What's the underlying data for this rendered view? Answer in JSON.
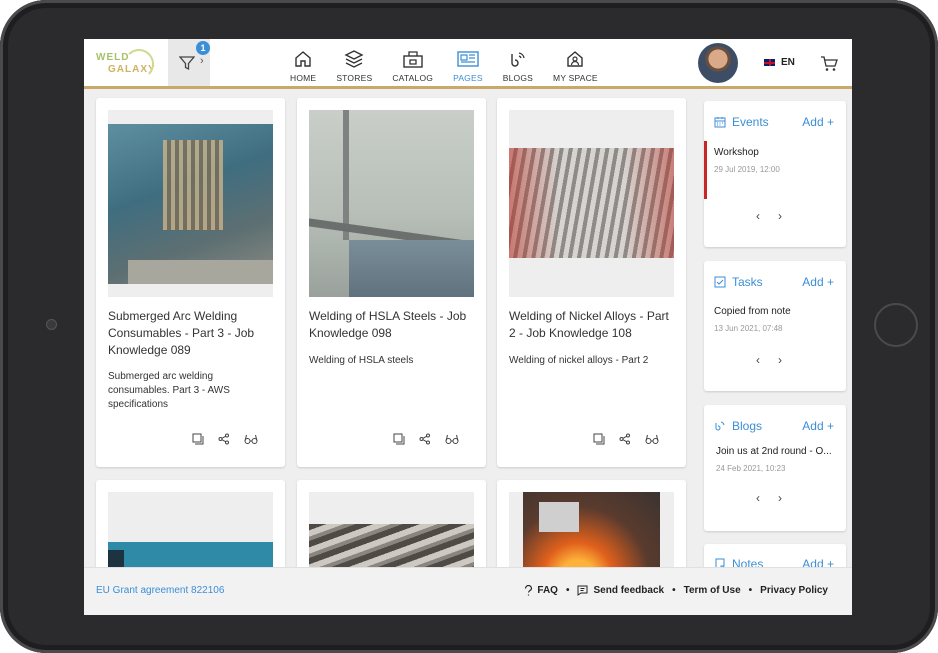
{
  "header": {
    "logo_line1": "WELD",
    "logo_line2": "GALAXY",
    "filter_badge": "1",
    "filter_chevron": "›",
    "nav": [
      {
        "label": "HOME",
        "icon": "home-icon"
      },
      {
        "label": "STORES",
        "icon": "layers-icon"
      },
      {
        "label": "CATALOG",
        "icon": "catalog-icon"
      },
      {
        "label": "PAGES",
        "icon": "pages-icon",
        "active": true
      },
      {
        "label": "BLOGS",
        "icon": "blogs-icon"
      },
      {
        "label": "MY SPACE",
        "icon": "myspace-icon"
      }
    ],
    "language": "EN"
  },
  "cards": [
    {
      "title": "Submerged Arc Welding Consumables - Part 3 - Job Knowledge 089",
      "desc": "Submerged arc welding consumables. Part 3 - AWS specifications"
    },
    {
      "title": "Welding of HSLA Steels - Job Knowledge 098",
      "desc": "Welding of HSLA steels"
    },
    {
      "title": "Welding of Nickel Alloys - Part 2 - Job Knowledge 108",
      "desc": "Welding of nickel alloys - Part 2"
    }
  ],
  "panels": {
    "events": {
      "title": "Events",
      "add": "Add +",
      "item": "Workshop",
      "date": "29 Jul 2019, 12:00"
    },
    "tasks": {
      "title": "Tasks",
      "add": "Add +",
      "item": "Copied from note",
      "date": "13 Jun 2021, 07:48"
    },
    "blogs": {
      "title": "Blogs",
      "add": "Add +",
      "item": "Join us at 2nd round - O...",
      "date": "24 Feb 2021, 10:23"
    },
    "notes": {
      "title": "Notes",
      "add": "Add +"
    },
    "prev": "‹",
    "next": "›"
  },
  "footer": {
    "grant": "EU Grant agreement 822106",
    "faq": "FAQ",
    "feedback": "Send feedback",
    "terms": "Term of Use",
    "privacy": "Privacy Policy",
    "separator": "•"
  },
  "colors": {
    "accent": "#3b8fd6",
    "event_marker": "#c62828",
    "header_rule": "#c9a96b"
  }
}
